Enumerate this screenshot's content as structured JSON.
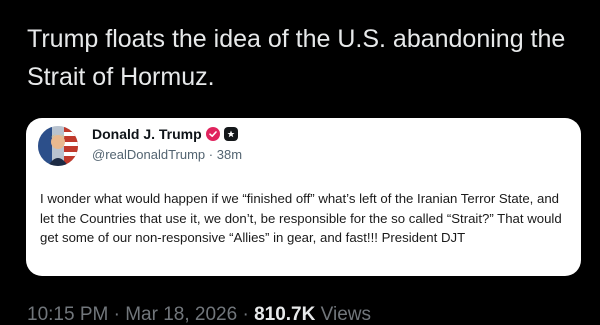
{
  "headline": "Trump floats the idea of the U.S. abandoning the Strait of Hormuz.",
  "quoted_post": {
    "author_name": "Donald J. Trump",
    "handle": "@realDonaldTrump",
    "separator": "·",
    "age": "38m",
    "text": "I wonder what would happen if we “finished off” what’s left of the Iranian Terror State, and let the Countries that use it, we don’t, be responsible for the so called “Strait?” That would get some of our non-responsive “Allies” in gear, and fast!!! President DJT",
    "badges": [
      "verified-badge-icon",
      "government-badge-icon"
    ],
    "colors": {
      "verified": "#e0245e",
      "government": "#14171a"
    }
  },
  "meta": {
    "time": "10:15 PM",
    "dot1": "·",
    "date": "Mar 18, 2026",
    "dot2": "·",
    "views_count": "810.7K",
    "views_label": "Views"
  }
}
